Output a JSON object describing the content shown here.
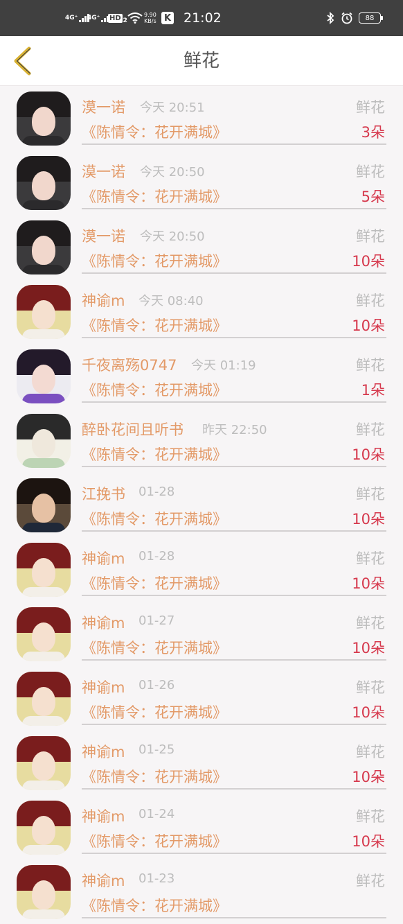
{
  "status_bar": {
    "sim1": "4G⁺",
    "sim2": "4G⁺",
    "hd": "HD",
    "hd_sub": "2",
    "net_speed_value": "9.90",
    "net_speed_unit": "KB/s",
    "app_badge": "K",
    "time": "21:02",
    "battery": "88"
  },
  "header": {
    "title": "鲜花"
  },
  "gift_type_label": "鲜花",
  "work_title": "《陈情令：花开满城》",
  "records": [
    {
      "name": "漠一诺",
      "time": "今天 20:51",
      "count": "3朵",
      "avatar": "avatar-girl-white-flower"
    },
    {
      "name": "漠一诺",
      "time": "今天 20:50",
      "count": "5朵",
      "avatar": "avatar-girl-white-flower"
    },
    {
      "name": "漠一诺",
      "time": "今天 20:50",
      "count": "10朵",
      "avatar": "avatar-girl-white-flower"
    },
    {
      "name": "神谕m",
      "time": "今天 08:40",
      "count": "10朵",
      "avatar": "avatar-boy-red-hair"
    },
    {
      "name": "千夜离殇0747",
      "time": "今天 01:19",
      "count": "1朵",
      "avatar": "avatar-girl-purple"
    },
    {
      "name": "醉卧花间且听书",
      "time": "昨天 22:50",
      "count": "10朵",
      "avatar": "avatar-ink-painting"
    },
    {
      "name": "江挽书",
      "time": "01-28",
      "count": "10朵",
      "avatar": "avatar-child"
    },
    {
      "name": "神谕m",
      "time": "01-28",
      "count": "10朵",
      "avatar": "avatar-boy-red-hair"
    },
    {
      "name": "神谕m",
      "time": "01-27",
      "count": "10朵",
      "avatar": "avatar-boy-red-hair"
    },
    {
      "name": "神谕m",
      "time": "01-26",
      "count": "10朵",
      "avatar": "avatar-boy-red-hair"
    },
    {
      "name": "神谕m",
      "time": "01-25",
      "count": "10朵",
      "avatar": "avatar-boy-red-hair"
    },
    {
      "name": "神谕m",
      "time": "01-24",
      "count": "10朵",
      "avatar": "avatar-boy-red-hair"
    },
    {
      "name": "神谕m",
      "time": "01-23",
      "count": "",
      "avatar": "avatar-boy-red-hair"
    }
  ],
  "colors": {
    "name_text": "#e39a68",
    "count_text": "#d6394d",
    "muted_text": "#bdbdbd",
    "back_arrow": "#d9b233",
    "status_bar_bg": "#404040"
  }
}
